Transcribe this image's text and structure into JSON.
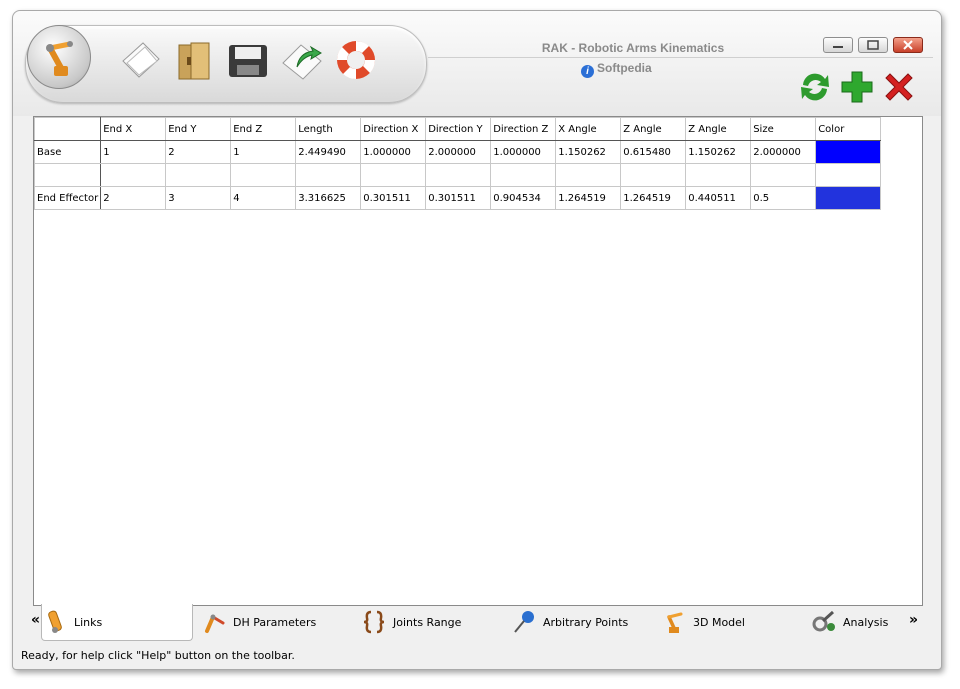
{
  "window": {
    "title": "RAK - Robotic Arms Kinematics",
    "subtitle": "Softpedia"
  },
  "toolbar": {
    "items": [
      {
        "name": "logo-icon"
      },
      {
        "name": "new-document-icon"
      },
      {
        "name": "open-folder-icon"
      },
      {
        "name": "save-floppy-icon"
      },
      {
        "name": "export-arrow-icon"
      },
      {
        "name": "help-lifebuoy-icon"
      }
    ],
    "actions": [
      {
        "name": "refresh-icon",
        "color": "#2e9b2e"
      },
      {
        "name": "add-icon",
        "color": "#2ea82e"
      },
      {
        "name": "delete-icon",
        "color": "#d42020"
      }
    ]
  },
  "grid": {
    "columns": [
      "End X",
      "End Y",
      "End Z",
      "Length",
      "Direction X",
      "Direction Y",
      "Direction Z",
      "X Angle",
      "Z Angle",
      "Z Angle",
      "Size",
      "Color"
    ],
    "rows": [
      {
        "label": "Base",
        "cells": [
          "1",
          "2",
          "1",
          "2.449490",
          "1.000000",
          "2.000000",
          "1.000000",
          "1.150262",
          "0.615480",
          "1.150262",
          "2.000000",
          ""
        ],
        "color": "#0000ff"
      },
      {
        "label": "",
        "cells": [
          "",
          "",
          "",
          "",
          "",
          "",
          "",
          "",
          "",
          "",
          "",
          ""
        ],
        "color": "#ffffff"
      },
      {
        "label": "End Effector",
        "cells": [
          "2",
          "3",
          "4",
          "3.316625",
          "0.301511",
          "0.301511",
          "0.904534",
          "1.264519",
          "1.264519",
          "0.440511",
          "0.5",
          ""
        ],
        "color": "#2233dd"
      }
    ]
  },
  "tabs": {
    "left_arrow": "«",
    "right_arrow": "»",
    "items": [
      {
        "label": "Links",
        "icon": "links-icon"
      },
      {
        "label": "DH Parameters",
        "icon": "dh-parameters-icon"
      },
      {
        "label": "Joints Range",
        "icon": "joints-range-icon"
      },
      {
        "label": "Arbitrary Points",
        "icon": "pushpin-icon"
      },
      {
        "label": "3D Model",
        "icon": "3d-model-icon"
      },
      {
        "label": "Analysis",
        "icon": "analysis-icon"
      }
    ]
  },
  "status": {
    "text": "Ready, for help click \"Help\" button on the toolbar."
  }
}
